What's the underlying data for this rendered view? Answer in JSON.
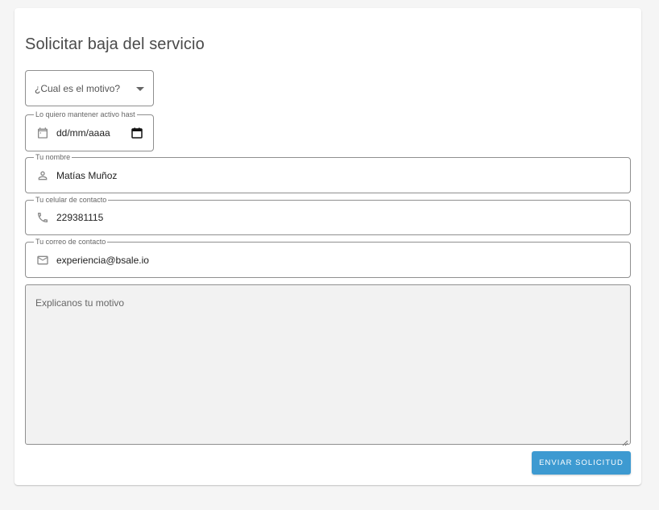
{
  "form": {
    "title": "Solicitar baja del servicio",
    "reason_select": {
      "placeholder": "¿Cual es el motivo?"
    },
    "keep_active_until": {
      "label": "Lo quiero mantener activo hast",
      "value": "dd/mm/aaaa"
    },
    "name": {
      "label": "Tu nombre",
      "value": "Matías Muñoz"
    },
    "phone": {
      "label": "Tu celular de contacto",
      "value": "229381115"
    },
    "email": {
      "label": "Tu correo de contacto",
      "value": "experiencia@bsale.io"
    },
    "message": {
      "placeholder": "Explicanos tu motivo"
    },
    "submit_label": "ENVIAR SOLICITUD"
  },
  "colors": {
    "accent": "#3d9ad1",
    "background": "#f5f5f5",
    "textarea_bg": "#f2f2f2"
  },
  "icons": {
    "date": "calendar-icon",
    "name": "person-icon",
    "phone": "phone-icon",
    "email": "mail-icon"
  }
}
